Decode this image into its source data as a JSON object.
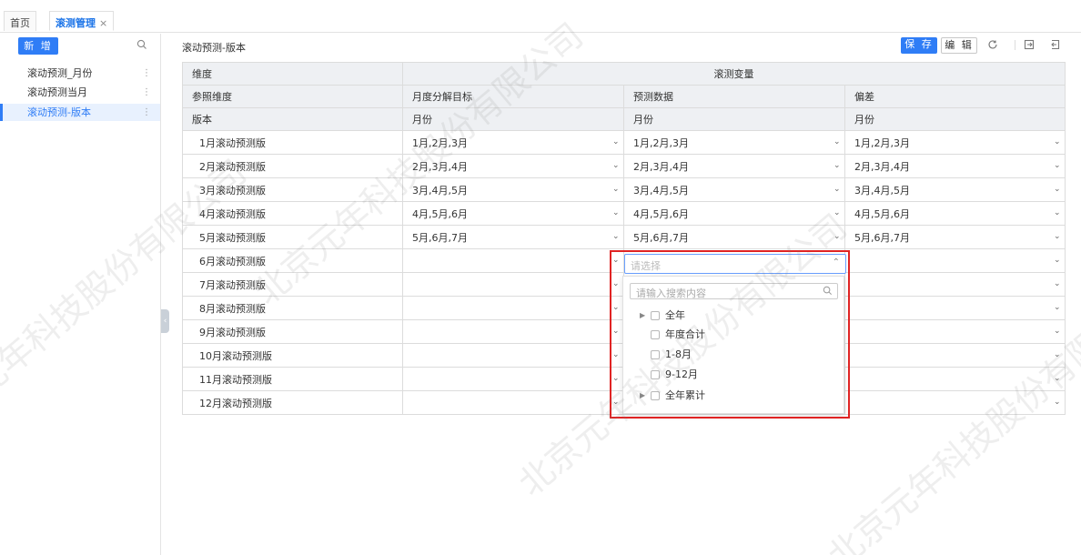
{
  "tabs": {
    "home": "首页",
    "active": "滚测管理",
    "close": "×"
  },
  "sidebar": {
    "add_label": "新 增",
    "items": [
      {
        "label": "滚动预测_月份",
        "dots": "⋮"
      },
      {
        "label": "滚动预测当月",
        "dots": "⋮"
      },
      {
        "label": "滚动预测-版本",
        "dots": "⋮",
        "active": true
      }
    ]
  },
  "main": {
    "title": "滚动预测-版本",
    "save_label": "保 存",
    "edit_label": "编 辑"
  },
  "table": {
    "header1": {
      "c1": "维度",
      "c2": "滚测变量"
    },
    "header2": [
      "参照维度",
      "月度分解目标",
      "预测数据",
      "偏差"
    ],
    "header3": [
      "版本",
      "月份",
      "月份",
      "月份"
    ],
    "rows": [
      [
        "1月滚动预测版",
        "1月,2月,3月",
        "1月,2月,3月",
        "1月,2月,3月"
      ],
      [
        "2月滚动预测版",
        "2月,3月,4月",
        "2月,3月,4月",
        "2月,3月,4月"
      ],
      [
        "3月滚动预测版",
        "3月,4月,5月",
        "3月,4月,5月",
        "3月,4月,5月"
      ],
      [
        "4月滚动预测版",
        "4月,5月,6月",
        "4月,5月,6月",
        "4月,5月,6月"
      ],
      [
        "5月滚动预测版",
        "5月,6月,7月",
        "5月,6月,7月",
        "5月,6月,7月"
      ],
      [
        "6月滚动预测版",
        "",
        "",
        ""
      ],
      [
        "7月滚动预测版",
        "",
        "",
        ""
      ],
      [
        "8月滚动预测版",
        "",
        "",
        ""
      ],
      [
        "9月滚动预测版",
        "",
        "",
        ""
      ],
      [
        "10月滚动预测版",
        "",
        "",
        ""
      ],
      [
        "11月滚动预测版",
        "",
        "",
        ""
      ],
      [
        "12月滚动预测版",
        "",
        "",
        ""
      ]
    ]
  },
  "dropdown": {
    "placeholder": "请选择",
    "search_placeholder": "请输入搜索内容",
    "options": [
      "全年",
      "年度合计",
      "1-8月",
      "9-12月",
      "全年累计"
    ]
  },
  "watermark": "北京元年科技股份有限公司",
  "colors": {
    "accent": "#2f7df6",
    "highlight": "#e02424"
  },
  "icons": [
    "search-icon",
    "refresh-icon",
    "export-icon",
    "import-icon",
    "chevron-down-icon",
    "chevron-up-icon",
    "caret-right-icon",
    "more-icon",
    "collapse-icon"
  ]
}
